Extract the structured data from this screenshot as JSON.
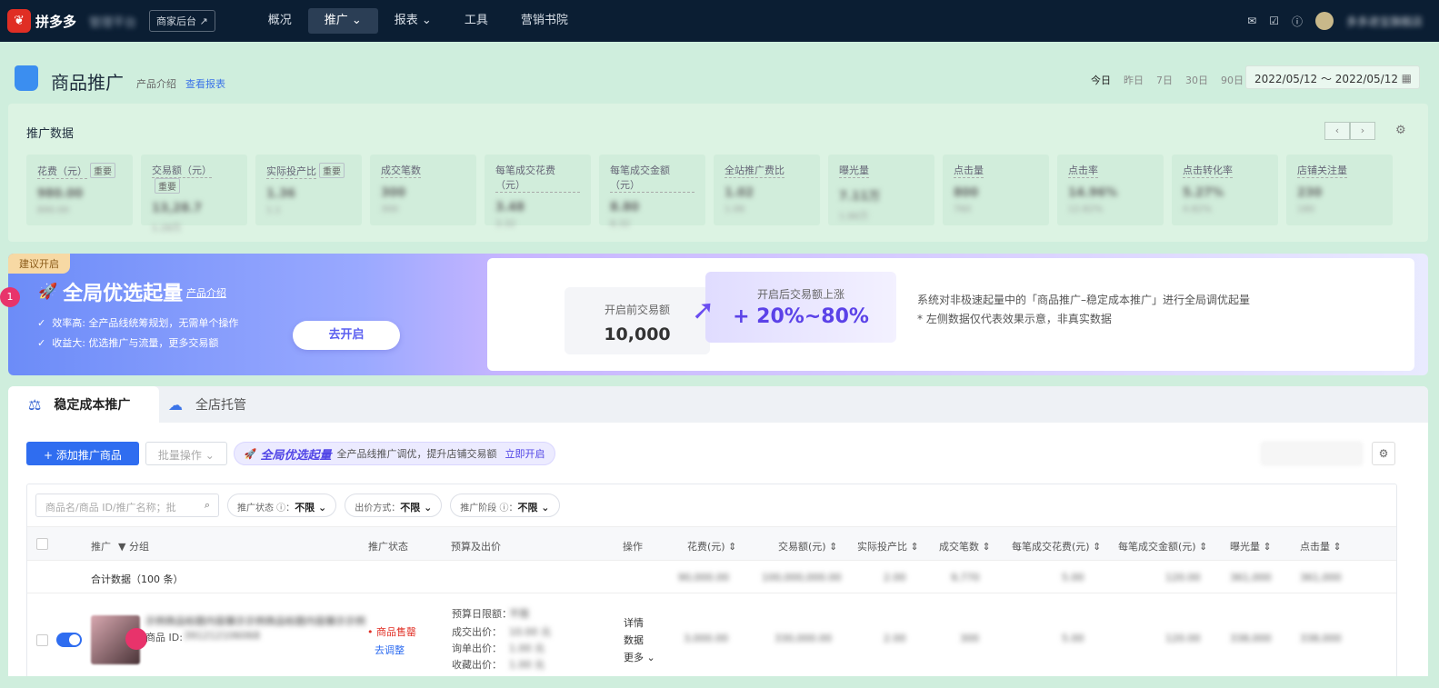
{
  "topnav": {
    "logo_icon": "pdd-logo-icon",
    "logo_text": "拼多多",
    "shop_name": "管理平台",
    "merchant_button": "商家后台 ↗",
    "items": [
      {
        "label": "概况",
        "active": false
      },
      {
        "label": "推广 ⌄",
        "active": true
      },
      {
        "label": "报表 ⌄",
        "active": false
      },
      {
        "label": "工具",
        "active": false
      },
      {
        "label": "营销书院",
        "active": false
      }
    ],
    "user_name": "多多进宝旗舰店"
  },
  "header": {
    "title": "商品推广",
    "intro_link": "产品介绍",
    "report_link": "查看报表",
    "date_tabs": [
      "今日",
      "昨日",
      "7日",
      "30日",
      "90日"
    ],
    "date_range": "2022/05/12 ～ 2022/05/12"
  },
  "data_panel": {
    "title": "推广数据",
    "metrics": [
      {
        "label": "花费（元）",
        "tag": "重要",
        "value": "980.00",
        "sub": "890.00"
      },
      {
        "label": "交易额（元）",
        "tag": "重要",
        "value": "13,28.7",
        "sub": "1.28万"
      },
      {
        "label": "实际投产比",
        "tag": "重要",
        "value": "1.36",
        "sub": "1.1"
      },
      {
        "label": "成交笔数",
        "tag": "",
        "value": "300",
        "sub": "300"
      },
      {
        "label": "每笔成交花费（元）",
        "tag": "",
        "value": "3.48",
        "sub": "3.32"
      },
      {
        "label": "每笔成交金额（元）",
        "tag": "",
        "value": "8.80",
        "sub": "8.32"
      },
      {
        "label": "全站推广费比",
        "tag": "",
        "value": "1.02",
        "sub": "1.06"
      },
      {
        "label": "曝光量",
        "tag": "",
        "value": "7.11万",
        "sub": "1.86万"
      },
      {
        "label": "点击量",
        "tag": "",
        "value": "800",
        "sub": "760"
      },
      {
        "label": "点击率",
        "tag": "",
        "value": "14.96%",
        "sub": "12.82%"
      },
      {
        "label": "点击转化率",
        "tag": "",
        "value": "5.27%",
        "sub": "4.82%"
      },
      {
        "label": "店铺关注量",
        "tag": "",
        "value": "230",
        "sub": "180"
      }
    ]
  },
  "banner": {
    "badge": "建议开启",
    "step": "1",
    "title": "全局优选起量",
    "intro_link": "产品介绍",
    "points": [
      "效率高: 全产品线统筹规划，无需单个操作",
      "收益大: 优选推广与流量，更多交易额"
    ],
    "cta": "去开启",
    "before_label": "开启前交易额",
    "before_value": "10,000",
    "after_label": "开启后交易额上涨",
    "after_value": "+ 20%~80%",
    "desc1": "系统对非极速起量中的「商品推广–稳定成本推广」进行全局调优起量",
    "desc2": "* 左侧数据仅代表效果示意，非真实数据"
  },
  "tabs": [
    {
      "label": "稳定成本推广",
      "icon": "scale-icon",
      "active": true
    },
    {
      "label": "全店托管",
      "icon": "cloud-check-icon",
      "active": false
    }
  ],
  "toolbar": {
    "add_button": "+ 添加推广商品",
    "batch_button": "批量操作 ⌄",
    "promo_title": "全局优选起量",
    "promo_text": "全产品线推广调优，提升店铺交易额",
    "promo_link": "立即开启"
  },
  "filters": {
    "search_placeholder": "商品名/商品 ID/推广名称；批",
    "status": {
      "label": "推广状态 ⓘ：",
      "value": "不限 ⌄"
    },
    "bid": {
      "label": "出价方式：",
      "value": "不限 ⌄"
    },
    "stage": {
      "label": "推广阶段 ⓘ：",
      "value": "不限 ⌄"
    }
  },
  "table": {
    "headers": [
      "推广",
      "▼ 分组",
      "推广状态",
      "预算及出价",
      "操作",
      "花费(元) ⇕",
      "交易额(元) ⇕",
      "实际投产比 ⇕",
      "成交笔数 ⇕",
      "每笔成交花费(元) ⇕",
      "每笔成交金额(元) ⇕",
      "曝光量 ⇕",
      "点击量 ⇕"
    ],
    "summary_label": "合计数据（100 条）",
    "summary_values": [
      "90,000.00",
      "100,000,000.00",
      "2.00",
      "9,770",
      "5.00",
      "120.00",
      "361,000",
      "361,000"
    ],
    "row": {
      "title": "示例商品标题内容展示示例商品标题内容展示示例",
      "id_label": "商品 ID:",
      "id_value": "391212106068",
      "status": "• 商品售罄",
      "status_link": "去调整",
      "budget_lines": [
        "预算日限额：",
        "成交出价：",
        "询单出价：",
        "收藏出价："
      ],
      "budget_values": [
        "不限",
        "10.00 元",
        "1.00 元",
        "1.00 元"
      ],
      "ops": [
        "详情",
        "数据",
        "更多 ⌄"
      ],
      "values": [
        "3,000.00",
        "330,000.00",
        "2.00",
        "300",
        "5.00",
        "120.00",
        "338,000",
        "338,000"
      ]
    }
  },
  "colors": {
    "nav_bg": "#0b1e33",
    "primary": "#2f6df0",
    "banner_accent": "#5b42e8",
    "danger": "#e02e24"
  }
}
